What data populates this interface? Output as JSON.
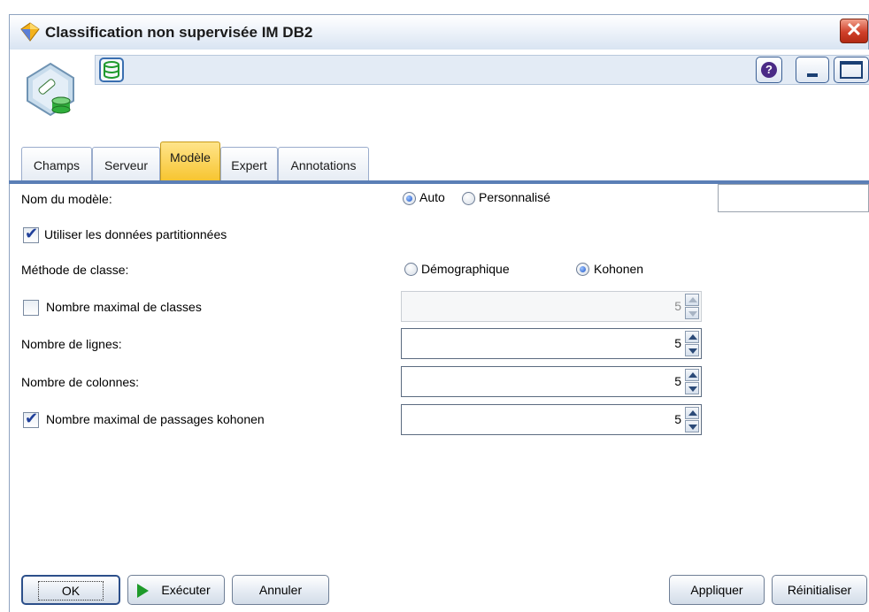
{
  "window": {
    "title": "Classification non supervisée IM DB2",
    "close_glyph": "✕"
  },
  "toolbar": {
    "help_glyph": "?"
  },
  "tabs": [
    {
      "label": "Champs",
      "active": false
    },
    {
      "label": "Serveur",
      "active": false
    },
    {
      "label": "Modèle",
      "active": true
    },
    {
      "label": "Expert",
      "active": false
    },
    {
      "label": "Annotations",
      "active": false
    }
  ],
  "form": {
    "model_name_label": "Nom du modèle:",
    "model_name_auto": "Auto",
    "model_name_custom": "Personnalisé",
    "model_name_value": "",
    "use_partitioned_label": "Utiliser les données partitionnées",
    "use_partitioned_checked": true,
    "class_method_label": "Méthode de classe:",
    "method_demographic": "Démographique",
    "method_kohonen": "Kohonen",
    "max_classes_label": "Nombre maximal de classes",
    "max_classes_checked": false,
    "max_classes_value": "5",
    "rows_label": "Nombre de lignes:",
    "rows_value": "5",
    "cols_label": "Nombre de colonnes:",
    "cols_value": "5",
    "max_passes_label": "Nombre maximal de passages kohonen",
    "max_passes_checked": true,
    "max_passes_value": "5"
  },
  "buttons": {
    "ok": "OK",
    "execute": "Exécuter",
    "cancel": "Annuler",
    "apply": "Appliquer",
    "reset": "Réinitialiser"
  },
  "icons": {
    "title": "diamond-icon",
    "node": "database-model-node-icon",
    "db": "database-icon"
  },
  "colors": {
    "active_tab": "#f7c531",
    "tab_rule": "#5b7fb6",
    "play": "#1e9a2a"
  }
}
